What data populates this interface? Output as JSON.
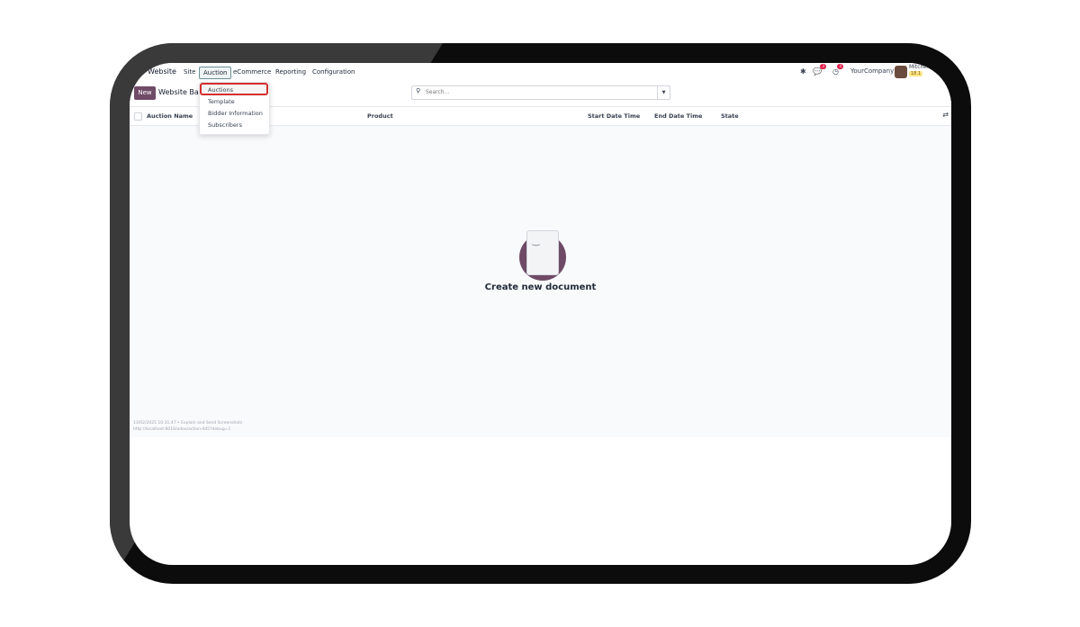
{
  "menu": {
    "app": "Website",
    "items": [
      "Site",
      "Auction",
      "eCommerce",
      "Reporting",
      "Configuration"
    ],
    "active_index": 1
  },
  "systray": {
    "chat_badge": "3",
    "activity_badge": "4",
    "company": "YourCompany",
    "user": "Mitchel",
    "database": "18.1"
  },
  "control": {
    "new_label": "New",
    "breadcrumb": "Website Bar",
    "search_placeholder": "Search..."
  },
  "dropdown": {
    "items": [
      "Auctions",
      "Template",
      "Bidder Information",
      "Subscribers"
    ],
    "highlighted": "Auctions"
  },
  "list": {
    "columns": [
      "Auction Name",
      "Product",
      "Start Date Time",
      "End Date Time",
      "State"
    ]
  },
  "empty": {
    "title": "Create new document"
  },
  "footer": {
    "line1": "13/02/2025 10:31:47 • Explain and Send Screenshots",
    "line2": "http://localhost:8016/odoo/action-445?debug=1"
  },
  "colors": {
    "primary": "#714b67",
    "highlight_border": "#d32f2f"
  }
}
